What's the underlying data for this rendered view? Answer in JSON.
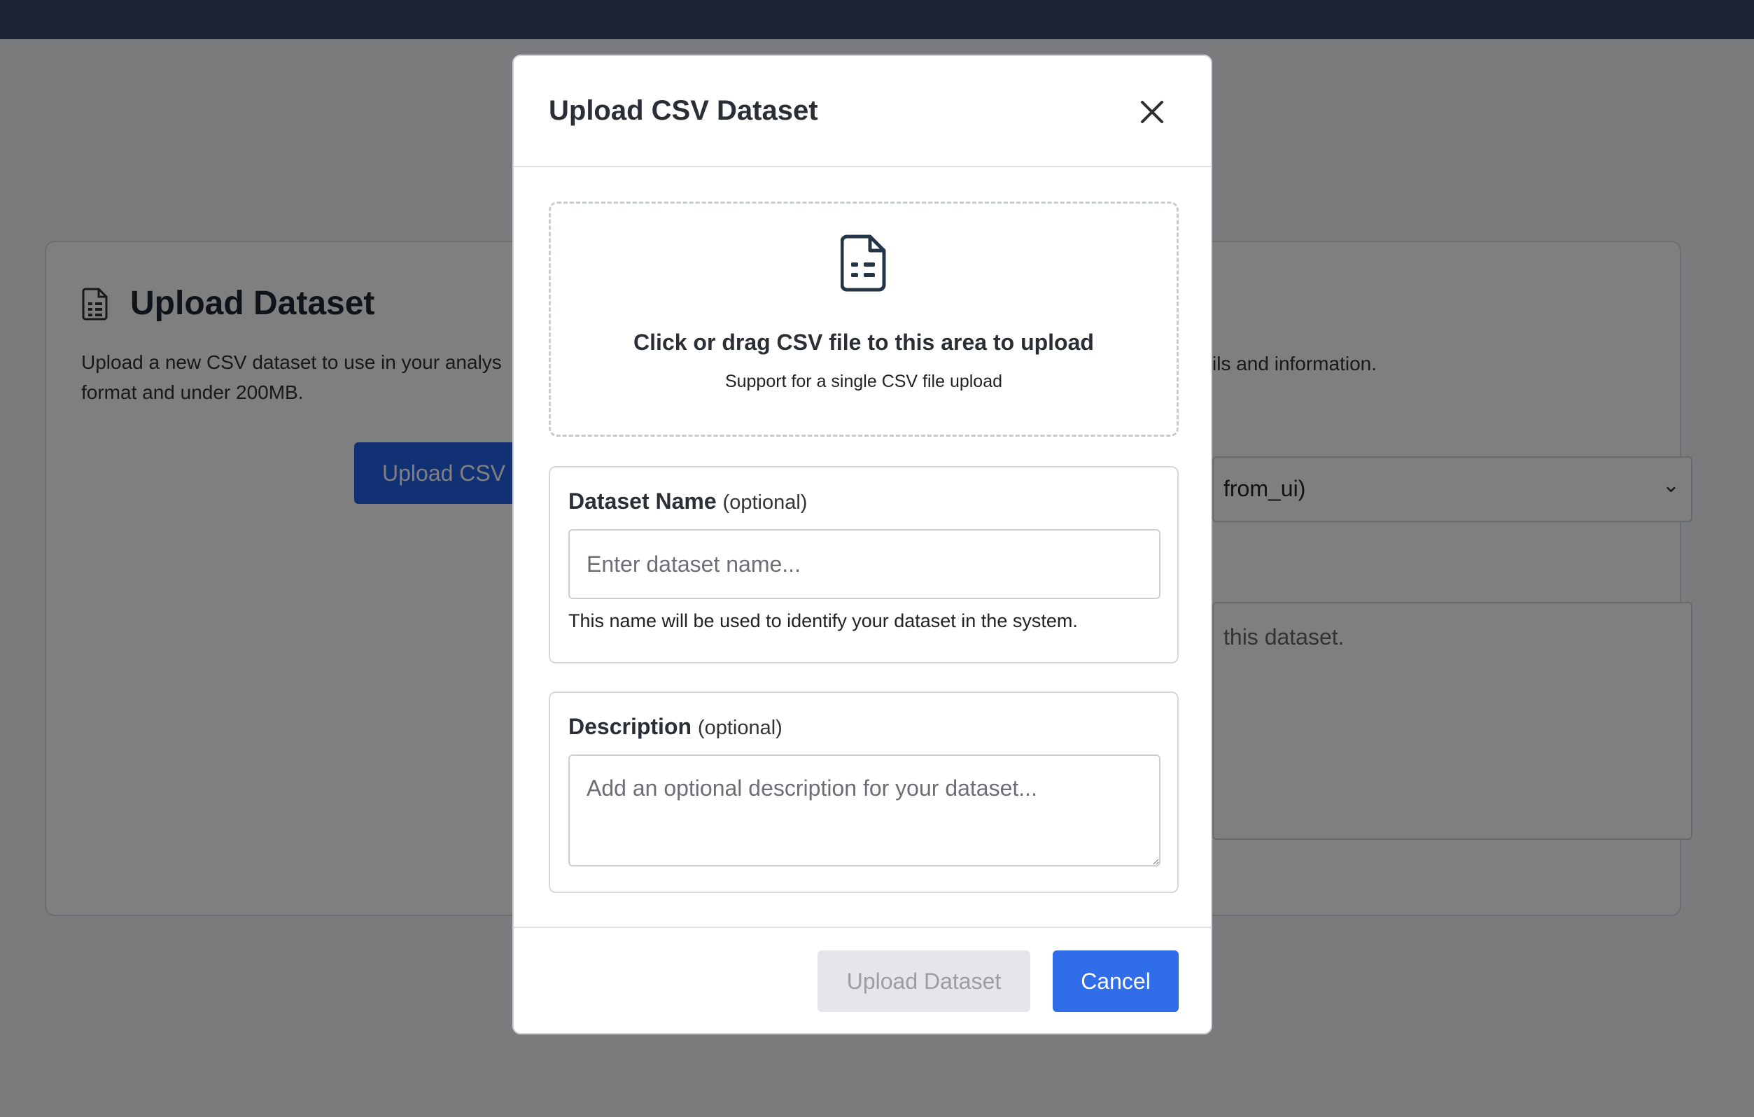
{
  "background": {
    "card": {
      "title": "Upload Dataset",
      "description": "Upload a new CSV dataset to use in your analys",
      "description_line2": "format and under 200MB.",
      "upload_button_label": "Upload CSV",
      "right_info_text": "ils and information.",
      "select_value": "from_ui)",
      "textarea_text": "this dataset."
    }
  },
  "modal": {
    "title": "Upload CSV Dataset",
    "dropzone": {
      "title": "Click or drag CSV file to this area to upload",
      "subtitle": "Support for a single CSV file upload"
    },
    "dataset_name": {
      "label": "Dataset Name",
      "optional": "(optional)",
      "placeholder": "Enter dataset name...",
      "value": "",
      "help": "This name will be used to identify your dataset in the system."
    },
    "description": {
      "label": "Description",
      "optional": "(optional)",
      "placeholder": "Add an optional description for your dataset...",
      "value": ""
    },
    "buttons": {
      "upload": "Upload Dataset",
      "cancel": "Cancel"
    }
  },
  "colors": {
    "primary": "#2f6ee8",
    "topbar": "#1b2433",
    "disabled_bg": "#e4e6e9",
    "disabled_text": "#9a9ea4"
  }
}
